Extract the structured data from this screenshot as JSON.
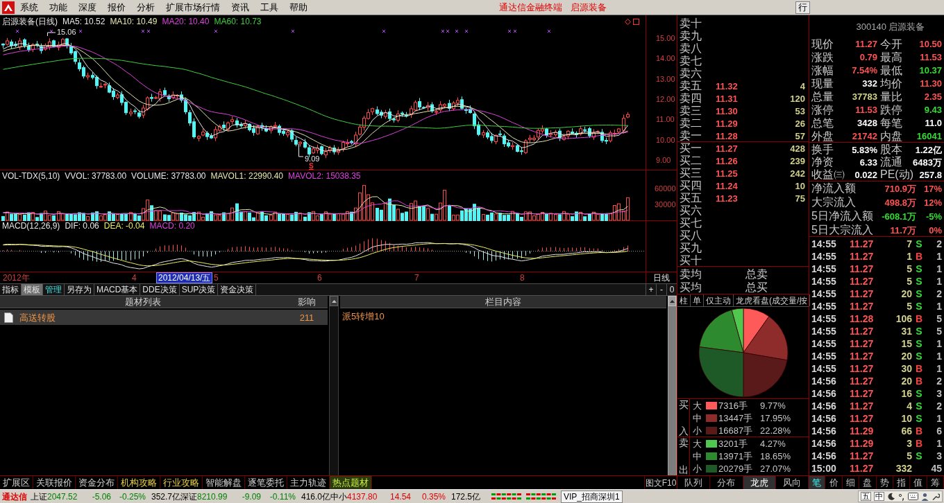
{
  "menu_bar": {
    "items": [
      "系统",
      "功能",
      "深度",
      "报价",
      "分析",
      "扩展市场行情",
      "资讯",
      "工具",
      "帮助"
    ],
    "center_texts": [
      "通达信金融终端",
      "启源装备"
    ],
    "right_button": "行"
  },
  "price_chart": {
    "title": "启源装备(日线)",
    "indicators": [
      {
        "label": "MA5: 10.52",
        "color": "#e8e8e8"
      },
      {
        "label": "MA10: 10.49",
        "color": "#e8e8b0"
      },
      {
        "label": "MA20: 10.40",
        "color": "#e040e0"
      },
      {
        "label": "MA60: 10.73",
        "color": "#40d040"
      }
    ],
    "y_ticks": [
      "15.00",
      "14.00",
      "13.00",
      "12.00",
      "11.00",
      "10.00",
      "9.00"
    ],
    "high_label": "15.06",
    "low_label": "9.09",
    "signal_label": "S"
  },
  "volume_chart": {
    "title": "VOL-TDX(5,10)",
    "indicators": [
      {
        "label": "VVOL: 37783.00",
        "color": "#e8e8e8"
      },
      {
        "label": "VOLUME: 37783.00",
        "color": "#e8e8e8"
      },
      {
        "label": "MAVOL1: 22990.40",
        "color": "#e8e8b0"
      },
      {
        "label": "MAVOL2: 15038.35",
        "color": "#e040e0"
      }
    ],
    "y_ticks": [
      "60000",
      "30000"
    ]
  },
  "macd_chart": {
    "title": "MACD(12,26,9)",
    "indicators": [
      {
        "label": "DIF: 0.06",
        "color": "#e8e8e8"
      },
      {
        "label": "DEA: -0.04",
        "color": "#f0f060"
      },
      {
        "label": "MACD: 0.20",
        "color": "#e040e0"
      }
    ]
  },
  "time_axis": {
    "labels": [
      "2012年",
      "4",
      "5",
      "6",
      "7",
      "8"
    ],
    "cursor_date": "2012/04/13/五",
    "period": "日线"
  },
  "indicator_tabs": [
    {
      "label": "指标",
      "selected": false,
      "highlighted": false
    },
    {
      "label": "模板",
      "selected": true,
      "highlighted": false
    },
    {
      "label": "管理",
      "selected": false,
      "highlighted": true
    },
    {
      "label": "另存为",
      "selected": false,
      "highlighted": false
    },
    {
      "label": "MACD基本",
      "selected": false,
      "highlighted": false
    },
    {
      "label": "DDE决策",
      "selected": false,
      "highlighted": false
    },
    {
      "label": "SUP决策",
      "selected": false,
      "highlighted": false
    },
    {
      "label": "资金决策",
      "selected": false,
      "highlighted": false
    }
  ],
  "zoom_buttons": [
    "+",
    "-",
    "0"
  ],
  "topic_list": {
    "columns": [
      "题材列表",
      "影响"
    ],
    "rows": [
      {
        "name": "高送转股",
        "impact": "211",
        "selected": true
      }
    ]
  },
  "content_panel": {
    "title": "栏目内容",
    "text": "派5转增10"
  },
  "order_book": {
    "asks": [
      {
        "label": "卖十"
      },
      {
        "label": "卖九"
      },
      {
        "label": "卖八"
      },
      {
        "label": "卖七"
      },
      {
        "label": "卖六"
      },
      {
        "label": "卖五",
        "price": "11.32",
        "volume": "4"
      },
      {
        "label": "卖四",
        "price": "11.31",
        "volume": "120"
      },
      {
        "label": "卖三",
        "price": "11.30",
        "volume": "53"
      },
      {
        "label": "卖二",
        "price": "11.29",
        "volume": "26"
      },
      {
        "label": "卖一",
        "price": "11.28",
        "volume": "57"
      }
    ],
    "bids": [
      {
        "label": "买一",
        "price": "11.27",
        "volume": "428"
      },
      {
        "label": "买二",
        "price": "11.26",
        "volume": "239"
      },
      {
        "label": "买三",
        "price": "11.25",
        "volume": "242"
      },
      {
        "label": "买四",
        "price": "11.24",
        "volume": "10"
      },
      {
        "label": "买五",
        "price": "11.23",
        "volume": "75"
      },
      {
        "label": "买六"
      },
      {
        "label": "买七"
      },
      {
        "label": "买八"
      },
      {
        "label": "买九"
      },
      {
        "label": "买十"
      }
    ],
    "summary": [
      {
        "label": "卖均",
        "total_label": "总卖"
      },
      {
        "label": "买均",
        "total_label": "总买"
      }
    ]
  },
  "flow_tabs": [
    {
      "label": "柱"
    },
    {
      "label": "单"
    },
    {
      "label": "仅主动"
    },
    {
      "label": "龙虎看盘(成交量/按"
    }
  ],
  "flow_pie": {
    "chart_data": {
      "type": "pie",
      "values": [
        9.77,
        17.95,
        22.28,
        4.27,
        18.65,
        27.07
      ]
    }
  },
  "flow_legend": [
    {
      "side_top": "买",
      "side_bottom": "入",
      "rows": [
        {
          "size": "大",
          "amount": "7316手",
          "percent": "9.77%",
          "color": "#ff5a5a"
        },
        {
          "size": "中",
          "amount": "13447手",
          "percent": "17.95%",
          "color": "#8e2c2c"
        },
        {
          "size": "小",
          "amount": "16687手",
          "percent": "22.28%",
          "color": "#5a1a1a"
        }
      ]
    },
    {
      "side_top": "卖",
      "side_bottom": "出",
      "rows": [
        {
          "size": "大",
          "amount": "3201手",
          "percent": "4.27%",
          "color": "#50c850"
        },
        {
          "size": "中",
          "amount": "13971手",
          "percent": "18.65%",
          "color": "#2e8a2e"
        },
        {
          "size": "小",
          "amount": "20279手",
          "percent": "27.07%",
          "color": "#1e5a28"
        }
      ]
    }
  ],
  "quote": {
    "title": "300140 启源装备",
    "stats": [
      {
        "label": "现价",
        "value": "11.27",
        "color": "#ff5454"
      },
      {
        "label": "今开",
        "value": "10.50",
        "color": "#ff5454"
      },
      {
        "label": "涨跌",
        "value": "0.79",
        "color": "#ff5454"
      },
      {
        "label": "最高",
        "value": "11.53",
        "color": "#ff5454"
      },
      {
        "label": "涨幅",
        "value": "7.54%",
        "color": "#ff5454"
      },
      {
        "label": "最低",
        "value": "10.37",
        "color": "#33dd33"
      },
      {
        "label": "现量",
        "value": "332",
        "color": "#ffffff"
      },
      {
        "label": "均价",
        "value": "11.30",
        "color": "#ff5454"
      },
      {
        "label": "总量",
        "value": "37783",
        "color": "#d2d28c"
      },
      {
        "label": "量比",
        "value": "2.35",
        "color": "#ff5454"
      },
      {
        "label": "涨停",
        "value": "11.53",
        "color": "#ff5454"
      },
      {
        "label": "跌停",
        "value": "9.43",
        "color": "#33dd33"
      },
      {
        "label": "总笔",
        "value": "3428",
        "color": "#ffffff"
      },
      {
        "label": "每笔",
        "value": "11.0",
        "color": "#ffffff"
      },
      {
        "label": "外盘",
        "value": "21742",
        "color": "#ff5454"
      },
      {
        "label": "内盘",
        "value": "16041",
        "color": "#33dd33"
      }
    ],
    "fundamentals": [
      {
        "label": "换手",
        "value": "5.83%"
      },
      {
        "label": "股本",
        "value": "1.22亿"
      },
      {
        "label": "净资",
        "value": "6.33"
      },
      {
        "label": "流通",
        "value": "6483万"
      },
      {
        "label": "收益㈢",
        "value": "0.022"
      },
      {
        "label": "PE(动)",
        "value": "257.8"
      }
    ]
  },
  "capital_flow": [
    {
      "label": "净流入额",
      "amount": "710.9万",
      "percent": "17%",
      "color": "#ff5454"
    },
    {
      "label": "大宗流入",
      "amount": "498.8万",
      "percent": "12%",
      "color": "#ff5454"
    },
    {
      "label": "5日净流入额",
      "amount": "-608.1万",
      "percent": "-5%",
      "color": "#33dd33"
    },
    {
      "label": "5日大宗流入",
      "amount": "11.7万",
      "percent": "0%",
      "color": "#ff5454"
    }
  ],
  "trades": [
    {
      "time": "14:55",
      "price": "11.27",
      "volume": "7",
      "side": "S",
      "color": "#33dd33",
      "count": "2"
    },
    {
      "time": "14:55",
      "price": "11.27",
      "volume": "1",
      "side": "B",
      "color": "#ff4040",
      "count": "1"
    },
    {
      "time": "14:55",
      "price": "11.27",
      "volume": "5",
      "side": "S",
      "color": "#33dd33",
      "count": "1"
    },
    {
      "time": "14:55",
      "price": "11.27",
      "volume": "5",
      "side": "S",
      "color": "#33dd33",
      "count": "1"
    },
    {
      "time": "14:55",
      "price": "11.27",
      "volume": "20",
      "side": "S",
      "color": "#33dd33",
      "count": "2"
    },
    {
      "time": "14:55",
      "price": "11.27",
      "volume": "5",
      "side": "S",
      "color": "#33dd33",
      "count": "1"
    },
    {
      "time": "14:55",
      "price": "11.28",
      "volume": "106",
      "side": "B",
      "color": "#ff4040",
      "count": "5"
    },
    {
      "time": "14:55",
      "price": "11.27",
      "volume": "31",
      "side": "S",
      "color": "#33dd33",
      "count": "5"
    },
    {
      "time": "14:55",
      "price": "11.27",
      "volume": "15",
      "side": "S",
      "color": "#33dd33",
      "count": "1"
    },
    {
      "time": "14:55",
      "price": "11.27",
      "volume": "20",
      "side": "S",
      "color": "#33dd33",
      "count": "1"
    },
    {
      "time": "14:55",
      "price": "11.27",
      "volume": "30",
      "side": "B",
      "color": "#ff4040",
      "count": "1"
    },
    {
      "time": "14:56",
      "price": "11.27",
      "volume": "20",
      "side": "B",
      "color": "#ff4040",
      "count": "2"
    },
    {
      "time": "14:56",
      "price": "11.27",
      "volume": "16",
      "side": "S",
      "color": "#33dd33",
      "count": "3"
    },
    {
      "time": "14:56",
      "price": "11.27",
      "volume": "4",
      "side": "S",
      "color": "#33dd33",
      "count": "2"
    },
    {
      "time": "14:56",
      "price": "11.27",
      "volume": "10",
      "side": "S",
      "color": "#33dd33",
      "count": "1"
    },
    {
      "time": "14:56",
      "price": "11.29",
      "volume": "66",
      "side": "B",
      "color": "#ff4040",
      "count": "6"
    },
    {
      "time": "14:56",
      "price": "11.29",
      "volume": "3",
      "side": "B",
      "color": "#ff4040",
      "count": "1"
    },
    {
      "time": "14:56",
      "price": "11.27",
      "volume": "5",
      "side": "S",
      "color": "#33dd33",
      "count": "3"
    },
    {
      "time": "15:00",
      "price": "11.27",
      "volume": "332",
      "count": "45"
    }
  ],
  "bottom_tabs": [
    {
      "label": "扩展区",
      "selected": false,
      "highlighted": false
    },
    {
      "label": "关联报价",
      "selected": false,
      "highlighted": false
    },
    {
      "label": "资金分布",
      "selected": false,
      "highlighted": false
    },
    {
      "label": "机构攻略",
      "selected": false,
      "highlighted": true
    },
    {
      "label": "行业攻略",
      "selected": false,
      "highlighted": true
    },
    {
      "label": "智能解盘",
      "selected": false,
      "highlighted": false
    },
    {
      "label": "逐笔委托",
      "selected": false,
      "highlighted": false
    },
    {
      "label": "主力轨迹",
      "selected": false,
      "highlighted": false
    },
    {
      "label": "热点题材",
      "selected": true,
      "highlighted": false
    }
  ],
  "f10_button": "图文F10",
  "panel_tabs": [
    {
      "label": "队列",
      "selected": false
    },
    {
      "label": "分布",
      "selected": false
    },
    {
      "label": "龙虎",
      "selected": true
    },
    {
      "label": "风向",
      "selected": false
    }
  ],
  "detail_tabs": [
    {
      "label": "笔",
      "selected": true
    },
    {
      "label": "价",
      "selected": false
    },
    {
      "label": "细",
      "selected": false
    },
    {
      "label": "盘",
      "selected": false
    },
    {
      "label": "势",
      "selected": false
    },
    {
      "label": "指",
      "selected": false
    },
    {
      "label": "值",
      "selected": false
    },
    {
      "label": "筹",
      "selected": false
    }
  ],
  "status_bar": {
    "brand": "通达信",
    "indices": [
      {
        "name": "上证",
        "value": "2047.52",
        "change": "-5.06",
        "percent": "-0.25%",
        "amount": "352.7亿",
        "kind": "down"
      },
      {
        "name": "深证",
        "value": "8210.99",
        "change": "-9.09",
        "percent": "-0.11%",
        "amount": "416.0亿",
        "kind": "down"
      },
      {
        "name": "中小",
        "value": "4137.80",
        "change": "14.54",
        "percent": "0.35%",
        "amount": "172.5亿",
        "kind": "up"
      }
    ],
    "server": "VIP_招商深圳1",
    "ime": [
      "五",
      "中"
    ]
  }
}
